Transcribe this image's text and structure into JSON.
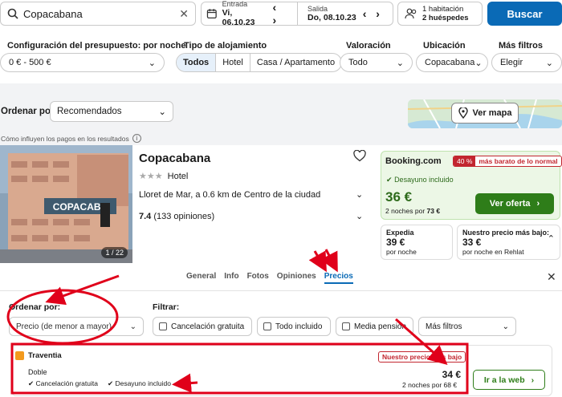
{
  "search": {
    "value": "Copacabana"
  },
  "dates": {
    "checkin_label": "Entrada",
    "checkin_value": "Vi, 06.10.23",
    "checkout_label": "Salida",
    "checkout_value": "Do, 08.10.23"
  },
  "guests": {
    "line1": "1 habitación",
    "line2": "2 huéspedes"
  },
  "search_button": "Buscar",
  "filters": {
    "budget_label": "Configuración del presupuesto: por noche",
    "budget_value": "0 € - 500 €",
    "type_label": "Tipo de alojamiento",
    "type_options": [
      "Todos",
      "Hotel",
      "Casa / Apartamento"
    ],
    "rating_label": "Valoración",
    "rating_value": "Todo",
    "location_label": "Ubicación",
    "location_value": "Copacabana",
    "more_label": "Más filtros",
    "more_value": "Elegir"
  },
  "sort": {
    "label": "Ordenar por",
    "value": "Recomendados"
  },
  "map_button": "Ver mapa",
  "payments_info": "Cómo influyen los pagos en los resultados",
  "hotel": {
    "name": "Copacabana",
    "stars": "★★★",
    "type": "Hotel",
    "location": "Lloret de Mar, a 0.6 km de Centro de la ciudad",
    "rating": "7.4",
    "reviews": "(133 opiniones)",
    "photo_count": "1 / 22",
    "photo_sign": "COPACABA"
  },
  "deal": {
    "provider": "Booking.com",
    "pct": "40 %",
    "pct_text": "más barato de lo normal",
    "breakfast": "Desayuno incluido",
    "price": "36 €",
    "nights_prefix": "2 noches por ",
    "nights_total": "73 €",
    "button": "Ver oferta"
  },
  "alt_deals": [
    {
      "name": "Expedia",
      "price": "39 €",
      "sub": "por noche"
    },
    {
      "name": "Nuestro precio más bajo:",
      "price": "33 €",
      "sub": "por noche en Rehlat"
    }
  ],
  "tabs": [
    "General",
    "Info",
    "Fotos",
    "Opiniones",
    "Precios"
  ],
  "detail": {
    "sort_label": "Ordenar por:",
    "sort_value": "Precio (de menor a mayor)",
    "filter_label": "Filtrar:",
    "checks": [
      "Cancelación gratuita",
      "Todo incluido",
      "Media pensión"
    ],
    "more_filters": "Más filtros"
  },
  "offer": {
    "provider": "Traventia",
    "room": "Doble",
    "amenities": [
      "Cancelación gratuita",
      "Desayuno incluido"
    ],
    "badge": "Nuestro precio más bajo",
    "price": "34 €",
    "nights": "2 noches por 68 €",
    "button": "Ir a la web"
  },
  "colors": {
    "primary": "#0a6ab6",
    "deal_green": "#2e7d19",
    "annotation_red": "#e0001a"
  }
}
